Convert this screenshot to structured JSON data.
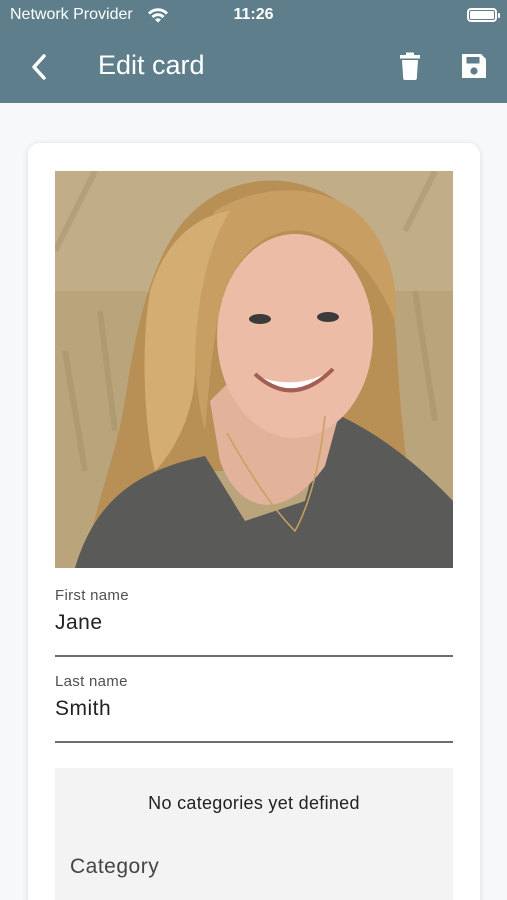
{
  "status_bar": {
    "carrier": "Network Provider",
    "time": "11:26"
  },
  "app_bar": {
    "title": "Edit card"
  },
  "form": {
    "first_name": {
      "label": "First name",
      "value": "Jane"
    },
    "last_name": {
      "label": "Last name",
      "value": "Smith"
    }
  },
  "categories": {
    "empty_message": "No categories yet defined",
    "label": "Category"
  },
  "icons": {
    "back": "chevron-left-icon",
    "delete": "trash-icon",
    "save": "floppy-disk-icon",
    "wifi": "wifi-icon",
    "battery": "battery-icon"
  },
  "colors": {
    "app_bar": "#5e7e8c",
    "background": "#f7f8f9",
    "card": "#ffffff"
  }
}
